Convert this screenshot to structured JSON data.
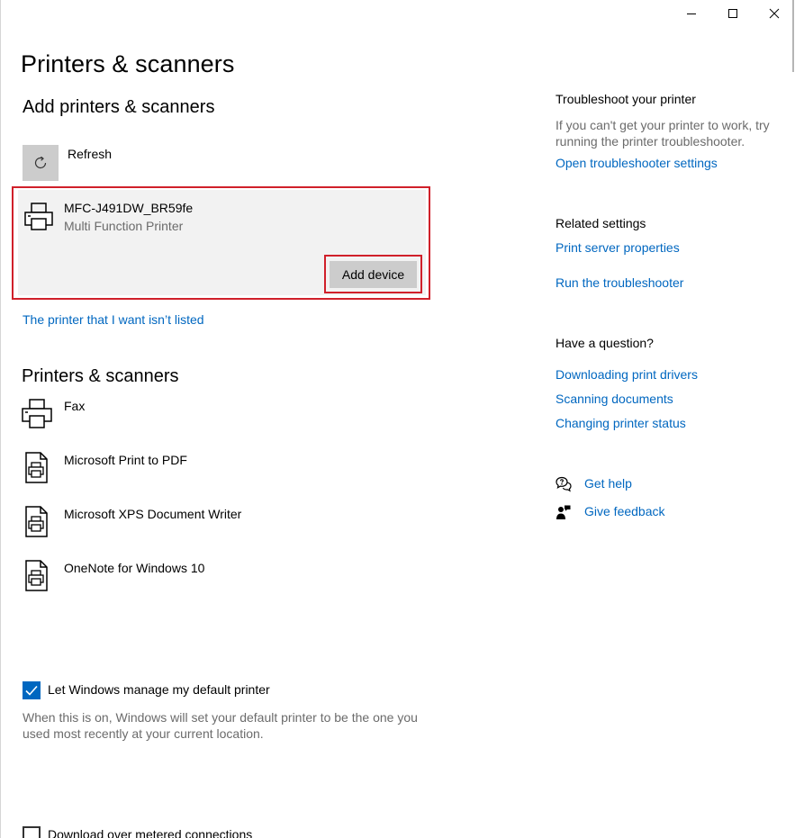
{
  "window": {
    "controls": [
      "minimize",
      "maximize",
      "close"
    ]
  },
  "page": {
    "title": "Printers & scanners"
  },
  "add_section": {
    "title": "Add printers & scanners",
    "refresh_label": "Refresh",
    "found_device": {
      "name": "MFC-J491DW_BR59fe",
      "type": "Multi Function Printer",
      "add_button": "Add device"
    },
    "not_listed_link": "The printer that I want isn’t listed"
  },
  "printers_section": {
    "title": "Printers & scanners",
    "items": [
      {
        "label": "Fax",
        "icon": "fax-printer-icon"
      },
      {
        "label": "Microsoft Print to PDF",
        "icon": "document-printer-icon"
      },
      {
        "label": "Microsoft XPS Document Writer",
        "icon": "document-printer-icon"
      },
      {
        "label": "OneNote for Windows 10",
        "icon": "document-printer-icon"
      }
    ]
  },
  "settings": {
    "manage_default": {
      "label": "Let Windows manage my default printer",
      "checked": true,
      "description": "When this is on, Windows will set your default printer to be the one you used most recently at your current location."
    },
    "metered": {
      "label": "Download over metered connections",
      "checked": false
    }
  },
  "sidebar": {
    "troubleshoot": {
      "heading": "Troubleshoot your printer",
      "text": "If you can't get your printer to work, try running the printer troubleshooter.",
      "link": "Open troubleshooter settings"
    },
    "related": {
      "heading": "Related settings",
      "links": [
        "Print server properties",
        "Run the troubleshooter"
      ]
    },
    "question": {
      "heading": "Have a question?",
      "links": [
        "Downloading print drivers",
        "Scanning documents",
        "Changing printer status"
      ]
    },
    "help": {
      "get_help": "Get help",
      "give_feedback": "Give feedback"
    }
  },
  "colors": {
    "accent": "#0067c0",
    "highlight": "#d0202a",
    "card_bg": "#f2f2f2",
    "button_bg": "#cccccc"
  }
}
